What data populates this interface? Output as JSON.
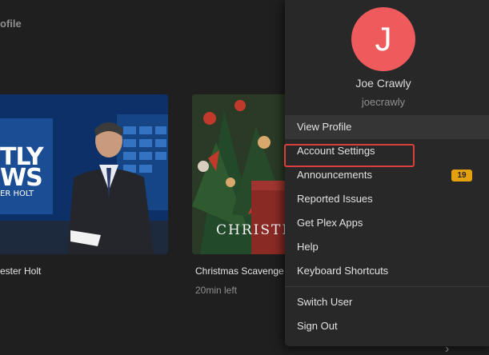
{
  "header": {
    "partial_label": "ofile"
  },
  "cards": [
    {
      "title": "ester Holt",
      "thumb_overlay_lines": [
        "TLY",
        "WS",
        "ER HOLT"
      ]
    },
    {
      "title": "Christmas Scavenge",
      "subtitle": "20min left",
      "thumb_overlay_text": "CHRISTM"
    }
  ],
  "account_menu": {
    "avatar_letter": "J",
    "avatar_color": "#ef5a5d",
    "user_name": "Joe Crawly",
    "username": "joecrawly",
    "items": [
      {
        "label": "View Profile"
      },
      {
        "label": "Account Settings",
        "highlighted": true
      },
      {
        "label": "Announcements",
        "badge": "19"
      },
      {
        "label": "Reported Issues"
      },
      {
        "label": "Get Plex Apps"
      },
      {
        "label": "Help"
      },
      {
        "label": "Keyboard Shortcuts"
      }
    ],
    "secondary_items": [
      {
        "label": "Switch User"
      },
      {
        "label": "Sign Out"
      }
    ]
  },
  "colors": {
    "background": "#1f1f1f",
    "menu_background": "#282828",
    "badge": "#e5a00d",
    "highlight_border": "#d9403a"
  },
  "icons": {
    "scroll_right": "chevron-right-icon"
  }
}
